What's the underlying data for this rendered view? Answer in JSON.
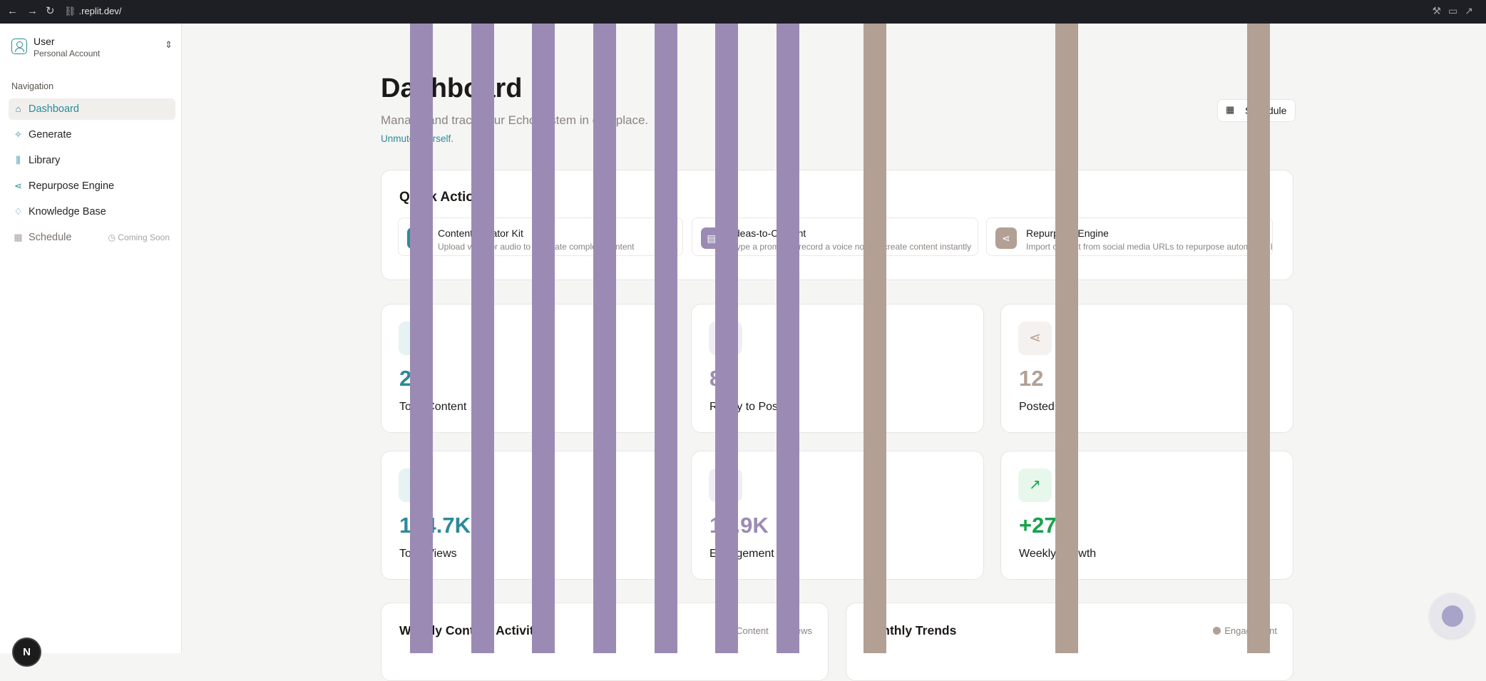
{
  "browser": {
    "url": ".replit.dev/"
  },
  "account": {
    "name": "User",
    "type": "Personal Account"
  },
  "sidebar": {
    "section_label": "Navigation",
    "items": [
      {
        "label": "Dashboard",
        "icon": "home-icon",
        "active": true
      },
      {
        "label": "Generate",
        "icon": "sparkles-icon"
      },
      {
        "label": "Library",
        "icon": "library-icon"
      },
      {
        "label": "Repurpose Engine",
        "icon": "share-icon"
      },
      {
        "label": "Knowledge Base",
        "icon": "lightbulb-icon"
      },
      {
        "label": "Schedule",
        "icon": "calendar-icon",
        "disabled": true,
        "badge": "Coming Soon"
      }
    ]
  },
  "header": {
    "title": "Dashboard",
    "subtitle": "Manage and track your EchoSystem in one place.",
    "tagline": "Unmute yourself.",
    "schedule_button": "Schedule"
  },
  "quick_actions": {
    "title": "Quick Actions",
    "items": [
      {
        "title": "Content Creator Kit",
        "description": "Upload video or audio to generate complete content",
        "icon": "upload-icon",
        "color": "#2b8a99"
      },
      {
        "title": "Ideas-to-Content",
        "description": "Type a prompt or record a voice note to create content instantly",
        "icon": "document-icon",
        "color": "#9b8bb4"
      },
      {
        "title": "Repurpose Engine",
        "description": "Import content from social media URLs to repurpose automatically",
        "icon": "share-icon",
        "color": "#b2a094"
      }
    ]
  },
  "stats": [
    {
      "value": "24",
      "label": "Total Content",
      "icon": "file-icon",
      "color": "#2b8a99",
      "bg": "#e6f2f3"
    },
    {
      "value": "8",
      "label": "Ready to Post",
      "icon": "clock-icon",
      "color": "#9b8bb4",
      "bg": "#f0edf5"
    },
    {
      "value": "12",
      "label": "Posted",
      "icon": "share-icon",
      "color": "#b2a094",
      "bg": "#f4f1ef"
    },
    {
      "value": "134.7K",
      "label": "Total Views",
      "icon": "eye-icon",
      "color": "#2b8a99",
      "bg": "#e6f2f3"
    },
    {
      "value": "10.9K",
      "label": "Engagement",
      "icon": "heart-icon",
      "color": "#9b8bb4",
      "bg": "#f0edf5"
    },
    {
      "value": "+27%",
      "label": "Weekly Growth",
      "icon": "trending-up-icon",
      "color": "#16a34a",
      "bg": "#e7f7ec"
    }
  ],
  "charts": [
    {
      "title": "Weekly Content Activity",
      "legend": [
        {
          "name": "Content",
          "color": "#2b8a99"
        },
        {
          "name": "Views",
          "color": "#9b8bb4"
        }
      ]
    },
    {
      "title": "Monthly Trends",
      "legend": [
        {
          "name": "Engagement",
          "color": "#b2a094"
        }
      ]
    }
  ],
  "assistant_badge": "N",
  "colors": {
    "accent": "#2b8a99",
    "purple_stripe": "#9b8bb4",
    "taupe_stripe": "#b2a094"
  }
}
